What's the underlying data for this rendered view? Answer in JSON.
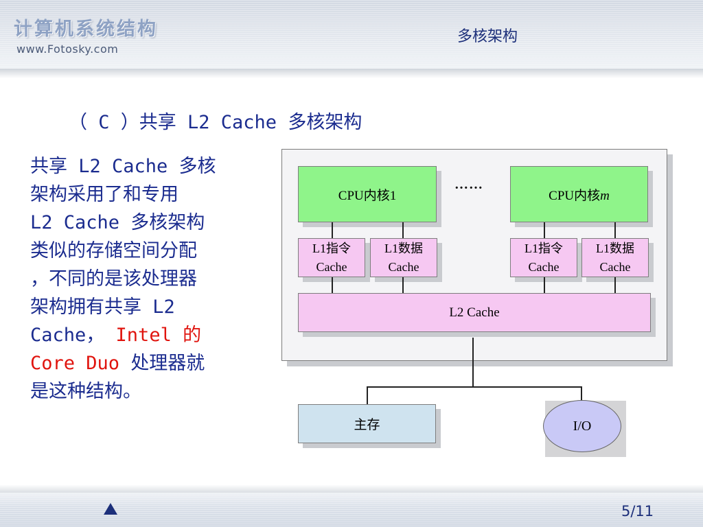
{
  "header": {
    "brand_title": "计算机系统结构",
    "brand_url": "www.Fotosky.com",
    "topic": "多核架构"
  },
  "slide": {
    "heading": "（ C ）共享 L2 Cache 多核架构",
    "body_lines": [
      {
        "text": "共享 L2 Cache 多核"
      },
      {
        "text": "架构采用了和专用"
      },
      {
        "text": "L2 Cache 多核架构"
      },
      {
        "text": "类似的存储空间分配"
      },
      {
        "text": "，不同的是该处理器"
      },
      {
        "text": "架构拥有共享 L2"
      },
      {
        "pre": "Cache， ",
        "highlight": "Intel 的"
      },
      {
        "highlight": "Core Duo ",
        "post": "处理器就"
      },
      {
        "text": "是这种结构。"
      }
    ]
  },
  "diagram": {
    "cpu1_label": "CPU内核1",
    "cpum_label_prefix": "CPU内核",
    "cpum_label_var": "m",
    "ellipsis": "……",
    "l1_inst_line1": "L1指令",
    "l1_inst_line2": "Cache",
    "l1_data_line1": "L1数据",
    "l1_data_line2": "Cache",
    "l2_label": "L2 Cache",
    "memory_label": "主存",
    "io_label": "I/O"
  },
  "footer": {
    "page_number": "5/11"
  },
  "colors": {
    "heading_blue": "#1b2c8f",
    "highlight_red": "#e0140e",
    "cpu_green": "#8ff48a",
    "cache_pink": "#f6c8f2",
    "memory_blue": "#cfe3ef",
    "io_lavender": "#c9c9f6"
  }
}
